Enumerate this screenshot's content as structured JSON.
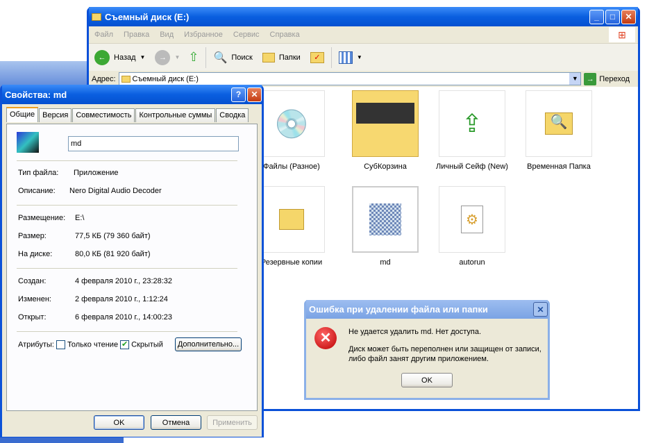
{
  "explorer": {
    "title": "Съемный диск (E:)",
    "menu": [
      "Файл",
      "Правка",
      "Вид",
      "Избранное",
      "Сервис",
      "Справка"
    ],
    "toolbar": {
      "back": "Назад",
      "search": "Поиск",
      "folders": "Папки"
    },
    "address_label": "Адрес:",
    "address_value": "Съемный диск (E:)",
    "go": "Переход",
    "items": [
      "Файлы (Разное)",
      "СубКорзина",
      "Личный Сейф (New)",
      "Временная Папка",
      "Резервные копии",
      "md",
      "autorun"
    ]
  },
  "properties": {
    "title": "Свойства: md",
    "tabs": [
      "Общие",
      "Версия",
      "Совместимость",
      "Контрольные суммы",
      "Сводка"
    ],
    "name": "md",
    "fields": [
      {
        "label": "Тип файла:",
        "value": "Приложение"
      },
      {
        "label": "Описание:",
        "value": "Nero Digital Audio Decoder"
      },
      {
        "label": "Размещение:",
        "value": "E:\\"
      },
      {
        "label": "Размер:",
        "value": "77,5 КБ (79 360 байт)"
      },
      {
        "label": "На диске:",
        "value": "80,0 КБ (81 920 байт)"
      },
      {
        "label": "Создан:",
        "value": "4 февраля 2010 г., 23:28:32"
      },
      {
        "label": "Изменен:",
        "value": "2 февраля 2010 г., 1:12:24"
      },
      {
        "label": "Открыт:",
        "value": "6 февраля 2010 г., 14:00:23"
      }
    ],
    "attributes_label": "Атрибуты:",
    "readonly": "Только чтение",
    "readonly_checked": false,
    "hidden": "Скрытый",
    "hidden_checked": true,
    "advanced": "Дополнительно...",
    "ok": "OK",
    "cancel": "Отмена",
    "apply": "Применить"
  },
  "error": {
    "title": "Ошибка при удалении файла или папки",
    "line1": "Не удается удалить md. Нет доступа.",
    "line2": "Диск может быть переполнен или защищен от записи,",
    "line3": "либо файл занят другим приложением.",
    "ok": "OK"
  }
}
